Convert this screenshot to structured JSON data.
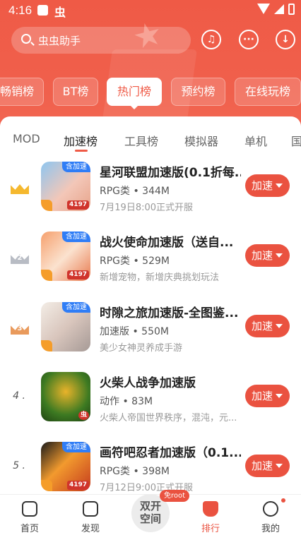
{
  "status_bar": {
    "time": "4:16",
    "app_glyph": "虫"
  },
  "search": {
    "placeholder": "虫虫助手"
  },
  "header_icons": [
    "headset-icon",
    "chat-icon",
    "download-icon"
  ],
  "categories": [
    {
      "label": "畅销榜",
      "active": false
    },
    {
      "label": "BT榜",
      "active": false
    },
    {
      "label": "热门榜",
      "active": true
    },
    {
      "label": "预约榜",
      "active": false
    },
    {
      "label": "在线玩榜",
      "active": false
    }
  ],
  "subtabs": [
    {
      "label": "MOD",
      "active": false
    },
    {
      "label": "加速榜",
      "active": true
    },
    {
      "label": "工具榜",
      "active": false
    },
    {
      "label": "模拟器",
      "active": false
    },
    {
      "label": "单机",
      "active": false
    },
    {
      "label": "国",
      "active": false
    }
  ],
  "games": [
    {
      "rank": "1",
      "rank_style": "gold",
      "badge": "含加速",
      "score": "4197",
      "title": "星河联盟加速版(0.1折每...",
      "meta": "RPG类 • 344M",
      "desc": "7月19日8:00正式开服",
      "button": "加速"
    },
    {
      "rank": "2",
      "rank_style": "silver",
      "badge": "含加速",
      "score": "4197",
      "title": "战火使命加速版（送自...",
      "meta": "RPG类 • 529M",
      "desc": "新增宠物，新增庆典挑划玩法",
      "button": "加速"
    },
    {
      "rank": "3",
      "rank_style": "bronze",
      "badge": "含加速",
      "score": "",
      "title": "时隙之旅加速版-全图鉴...",
      "meta": "加速版 • 550M",
      "desc": "美少女神灵养成手游",
      "button": "加速"
    },
    {
      "rank": "4 .",
      "rank_style": "plain",
      "badge": "",
      "score": "",
      "title": "火柴人战争加速版",
      "meta": "动作 • 83M",
      "desc": "火柴人帝国世界秩序，混沌，元...",
      "button": "加速"
    },
    {
      "rank": "5 .",
      "rank_style": "plain",
      "badge": "含加速",
      "score": "4197",
      "title": "画符吧忍者加速版（0.1...",
      "meta": "RPG类 • 398M",
      "desc": "7月12日9:00正式开服",
      "button": "加速"
    }
  ],
  "bottom_nav": {
    "home": "首页",
    "discover": "发现",
    "dual_space": "双开空间",
    "dual_badge": "免root",
    "ranking": "排行",
    "mine": "我的"
  },
  "colors": {
    "accent": "#ea5240",
    "header": "#ef5a46",
    "speed_tag": "#2f7df6",
    "gold": "#f5b82e",
    "silver": "#b8bcc4",
    "bronze": "#e99a5c"
  }
}
